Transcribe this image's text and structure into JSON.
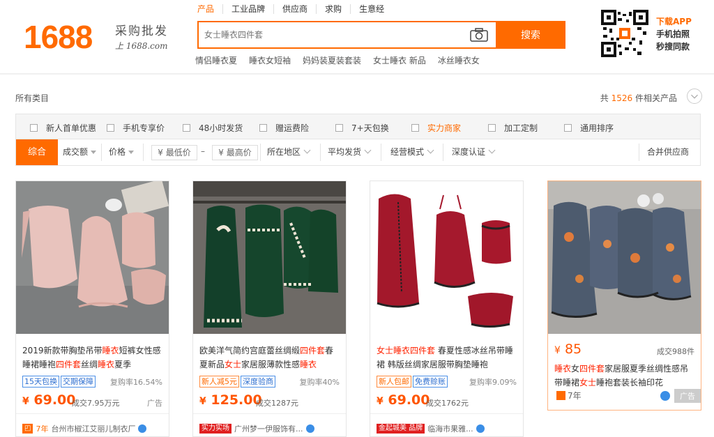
{
  "header": {
    "logo": "1688",
    "slogan_line1": "采购批发",
    "slogan_line2": "上 1688.com",
    "search_tabs": [
      "产品",
      "工业品牌",
      "供应商",
      "求购",
      "生意经"
    ],
    "search_placeholder": "女士睡衣四件套",
    "search_button": "搜索",
    "hot_words": [
      "情侣睡衣夏",
      "睡衣女短袖",
      "妈妈装夏装套装",
      "女士睡衣 新品",
      "冰丝睡衣女"
    ],
    "app": [
      "下载APP",
      "手机拍照",
      "秒搜同款"
    ]
  },
  "crumb": "所有类目",
  "result_count": {
    "prefix": "共",
    "number": "1526",
    "suffix": "件相关产品"
  },
  "filters": [
    "新人首单优惠",
    "手机专享价",
    "48小时发货",
    "赠运费险",
    "7+天包换",
    "实力商家",
    "加工定制",
    "通用排序"
  ],
  "sort": {
    "active": "综合",
    "items": [
      "成交额",
      "价格"
    ],
    "price_min": "¥ 最低价",
    "price_dash": "–",
    "price_max": "¥ 最高价",
    "dropdowns": [
      "所在地区",
      "平均发货",
      "经营模式",
      "深度认证"
    ],
    "merge": "合并供应商"
  },
  "products": [
    {
      "title_parts": [
        {
          "t": "2019新款带胸垫吊带",
          "h": false
        },
        {
          "t": "睡衣",
          "h": true
        },
        {
          "t": "短裤女性感睡裙睡袍",
          "h": false
        },
        {
          "t": "四件套",
          "h": true
        },
        {
          "t": "丝绸",
          "h": false
        },
        {
          "t": "睡衣",
          "h": true
        },
        {
          "t": "夏季",
          "h": false
        }
      ],
      "tags": [
        "15天包换",
        "交期保障"
      ],
      "tag_styles": [
        "b",
        "b"
      ],
      "repeat": "复购率16.54%",
      "currency": "¥",
      "price": "69.00",
      "deal": "成交7.95万元",
      "ad": "广告",
      "supplier_badge": "7年",
      "supplier": "台州市椒江艾丽儿制衣厂"
    },
    {
      "title_parts": [
        {
          "t": "欧美洋气简约宫庭蕾丝绸缎",
          "h": false
        },
        {
          "t": "四件套",
          "h": true
        },
        {
          "t": "春夏新品",
          "h": false
        },
        {
          "t": "女士",
          "h": true
        },
        {
          "t": "家居服薄款性感",
          "h": false
        },
        {
          "t": "睡衣",
          "h": true
        }
      ],
      "tags": [
        "新人减5元",
        "深度验商"
      ],
      "tag_styles": [
        "o",
        "b"
      ],
      "repeat": "复购率40%",
      "currency": "¥",
      "price": "125.00",
      "deal": "成交1287元",
      "supplier_badge": "实力实场",
      "supplier": "广州梦一伊服饰有..."
    },
    {
      "title_parts": [
        {
          "t": "女士睡衣四件套",
          "h": true
        },
        {
          "t": " 春夏性感冰丝吊带睡裙 韩版丝绸家居服带胸垫睡袍",
          "h": false
        }
      ],
      "tags": [
        "新人包邮",
        "免费赊账"
      ],
      "tag_styles": [
        "o",
        "b"
      ],
      "repeat": "复购率9.09%",
      "currency": "¥",
      "price": "69.00",
      "deal": "成交1762元",
      "supplier_badge": "金起城美 品牌",
      "supplier": "临海市果雅..."
    }
  ],
  "ad_card": {
    "currency": "¥",
    "price": "85",
    "deal": "成交988件",
    "title_parts": [
      {
        "t": "睡衣",
        "h": true
      },
      {
        "t": "女",
        "h": false
      },
      {
        "t": "四件套",
        "h": true
      },
      {
        "t": "家居服夏季丝绸性感吊带睡裙",
        "h": false
      },
      {
        "t": "女士",
        "h": true
      },
      {
        "t": "睡袍套装长袖印花",
        "h": false
      }
    ],
    "years": "7年",
    "ad": "广告"
  },
  "colors": {
    "accent": "#ff6a00",
    "highlight": "#ff2200"
  }
}
